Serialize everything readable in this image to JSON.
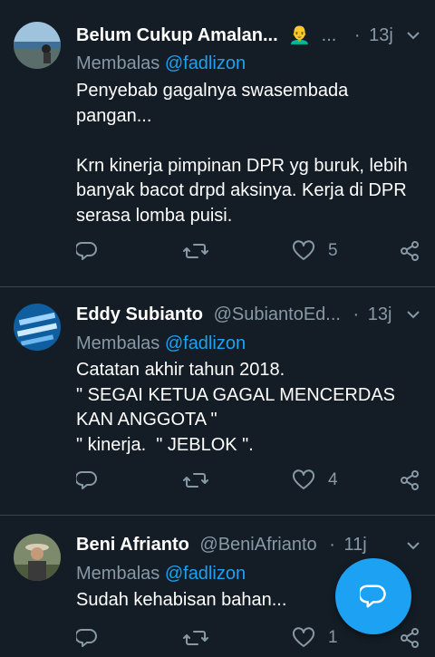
{
  "tweets": [
    {
      "name": "Belum Cukup Amalan...",
      "emoji": "👨‍🦲",
      "handle": "...",
      "dot": "·",
      "time": "13j",
      "reply_label": "Membalas",
      "reply_mention": "@fadlizon",
      "text": "Penyebab gagalnya swasembada\npangan...\n\nKrn kinerja pimpinan DPR yg buruk, lebih\nbanyak bacot drpd aksinya. Kerja di DPR\nserasa lomba puisi.",
      "likes": "5"
    },
    {
      "name": "Eddy Subianto",
      "handle": "@SubiantoEd...",
      "dot": "·",
      "time": "13j",
      "reply_label": "Membalas",
      "reply_mention": "@fadlizon",
      "text": "Catatan akhir tahun 2018.\n\" SEGAI KETUA GAGAL MENCERDAS\nKAN ANGGOTA \"\n\" kinerja.  \" JEBLOK \".",
      "likes": "4"
    },
    {
      "name": "Beni Afrianto",
      "handle": "@BeniAfrianto",
      "dot": "·",
      "time": "11j",
      "reply_label": "Membalas",
      "reply_mention": "@fadlizon",
      "text": "Sudah kehabisan bahan...",
      "likes": "1"
    }
  ],
  "colors": {
    "background": "#141d26",
    "muted": "#8899a6",
    "accent": "#1da1f2",
    "divider": "#38444d"
  },
  "icons": {
    "reply": "reply-icon",
    "retweet": "retweet-icon",
    "like": "heart-icon",
    "share": "share-icon",
    "menu": "chevron-down-icon",
    "compose": "compose-reply-icon"
  }
}
